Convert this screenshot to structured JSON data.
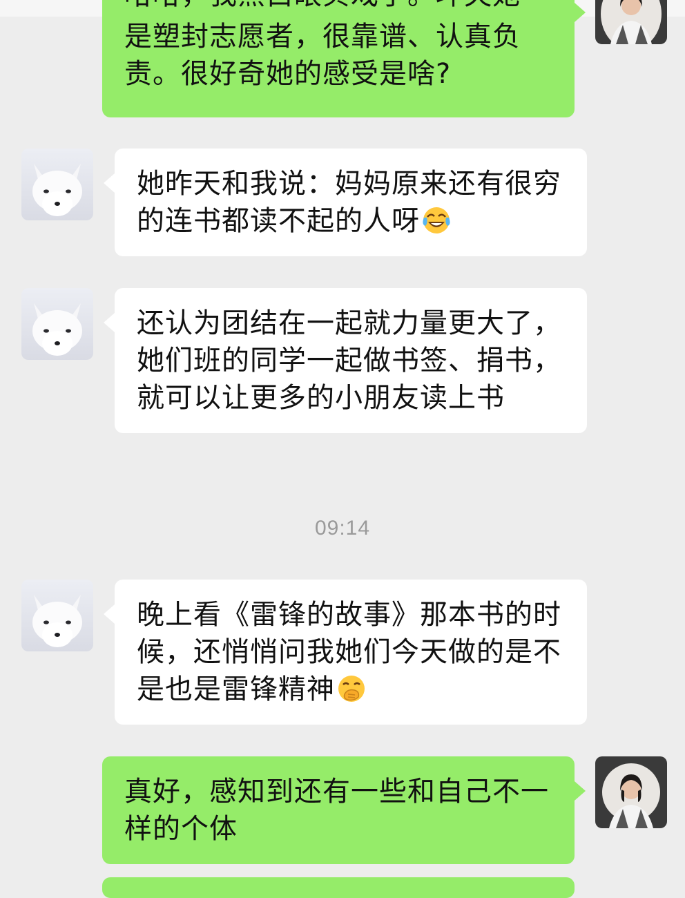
{
  "messages": [
    {
      "side": "outgoing",
      "text": "是塑封志愿者，很靠谱、认真负责。很好奇她的感受是啥?",
      "partial_top_text": "哈哈，我黑白眼贝戏了。坏央她"
    },
    {
      "side": "incoming",
      "text": "她昨天和我说：妈妈原来还有很穷的连书都读不起的人呀",
      "emoji": "face-with-tears-of-joy"
    },
    {
      "side": "incoming",
      "text": "还认为团结在一起就力量更大了，她们班的同学一起做书签、捐书，就可以让更多的小朋友读上书"
    },
    {
      "side": "incoming",
      "text": "晚上看《雷锋的故事》那本书的时候，还悄悄问我她们今天做的是不是也是雷锋精神",
      "emoji": "face-with-hand-over-mouth"
    },
    {
      "side": "outgoing",
      "text": "真好，感知到还有一些和自己不一样的个体"
    }
  ],
  "timestamp": "09:14",
  "colors": {
    "background": "#ededed",
    "outgoing_bubble": "#95ec69",
    "incoming_bubble": "#ffffff",
    "timestamp_text": "#9a9a9a"
  },
  "icons": {
    "incoming_avatar": "arctic-fox-avatar",
    "outgoing_avatar": "woman-portrait-avatar"
  }
}
